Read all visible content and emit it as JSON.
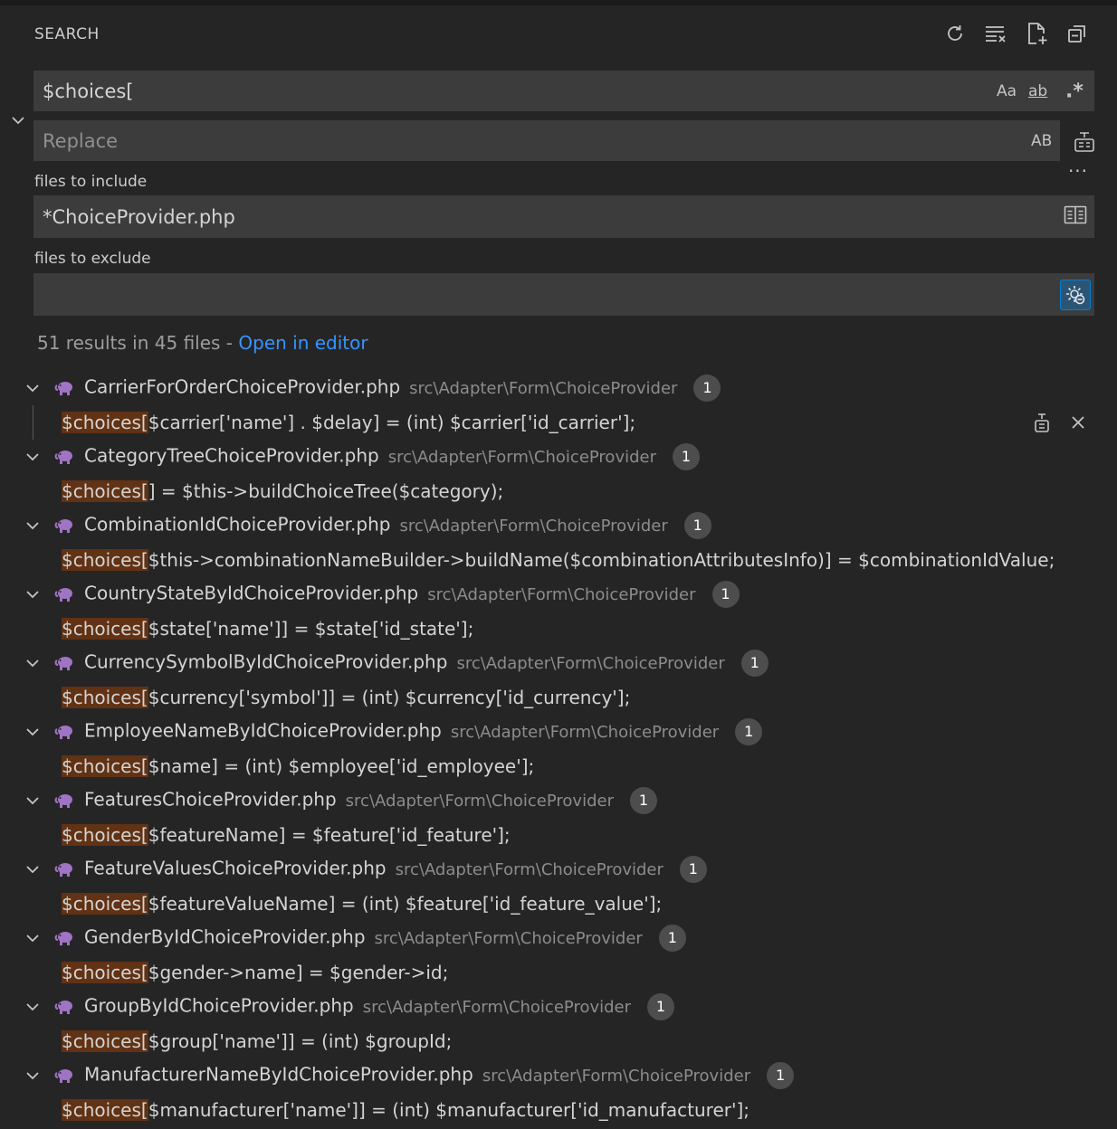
{
  "header": {
    "title": "SEARCH",
    "icons": [
      "refresh-icon",
      "clear-results-icon",
      "new-search-editor-icon",
      "collapse-all-icon"
    ]
  },
  "search": {
    "query": "$choices[",
    "match_case_label": "Aa",
    "whole_word_label": "ab",
    "regex_label": ".*"
  },
  "replace": {
    "placeholder": "Replace",
    "value": "",
    "preserve_case_label": "AB"
  },
  "include": {
    "label": "files to include",
    "value": "*ChoiceProvider.php"
  },
  "exclude": {
    "label": "files to exclude",
    "value": ""
  },
  "summary": {
    "text": "51 results in 45 files - ",
    "link": "Open in editor"
  },
  "results": [
    {
      "file": "CarrierForOrderChoiceProvider.php",
      "path": "src\\Adapter\\Form\\ChoiceProvider",
      "count": "1",
      "match": "$choices[",
      "rest": "$carrier['name'] . $delay] = (int) $carrier['id_carrier'];"
    },
    {
      "file": "CategoryTreeChoiceProvider.php",
      "path": "src\\Adapter\\Form\\ChoiceProvider",
      "count": "1",
      "match": "$choices[",
      "rest": "] = $this->buildChoiceTree($category);"
    },
    {
      "file": "CombinationIdChoiceProvider.php",
      "path": "src\\Adapter\\Form\\ChoiceProvider",
      "count": "1",
      "match": "$choices[",
      "rest": "$this->combinationNameBuilder->buildName($combinationAttributesInfo)] = $combinationIdValue;"
    },
    {
      "file": "CountryStateByIdChoiceProvider.php",
      "path": "src\\Adapter\\Form\\ChoiceProvider",
      "count": "1",
      "match": "$choices[",
      "rest": "$state['name']] = $state['id_state'];"
    },
    {
      "file": "CurrencySymbolByIdChoiceProvider.php",
      "path": "src\\Adapter\\Form\\ChoiceProvider",
      "count": "1",
      "match": "$choices[",
      "rest": "$currency['symbol']] = (int) $currency['id_currency'];"
    },
    {
      "file": "EmployeeNameByIdChoiceProvider.php",
      "path": "src\\Adapter\\Form\\ChoiceProvider",
      "count": "1",
      "match": "$choices[",
      "rest": "$name] = (int) $employee['id_employee'];"
    },
    {
      "file": "FeaturesChoiceProvider.php",
      "path": "src\\Adapter\\Form\\ChoiceProvider",
      "count": "1",
      "match": "$choices[",
      "rest": "$featureName] = $feature['id_feature'];"
    },
    {
      "file": "FeatureValuesChoiceProvider.php",
      "path": "src\\Adapter\\Form\\ChoiceProvider",
      "count": "1",
      "match": "$choices[",
      "rest": "$featureValueName] = (int) $feature['id_feature_value'];"
    },
    {
      "file": "GenderByIdChoiceProvider.php",
      "path": "src\\Adapter\\Form\\ChoiceProvider",
      "count": "1",
      "match": "$choices[",
      "rest": "$gender->name] = $gender->id;"
    },
    {
      "file": "GroupByIdChoiceProvider.php",
      "path": "src\\Adapter\\Form\\ChoiceProvider",
      "count": "1",
      "match": "$choices[",
      "rest": "$group['name']] = (int) $groupId;"
    },
    {
      "file": "ManufacturerNameByIdChoiceProvider.php",
      "path": "src\\Adapter\\Form\\ChoiceProvider",
      "count": "1",
      "match": "$choices[",
      "rest": "$manufacturer['name']] = (int) $manufacturer['id_manufacturer'];"
    }
  ],
  "colors": {
    "panel_bg": "#252526",
    "input_bg": "#3c3c3c",
    "link": "#3794ff",
    "match_highlight": "#613214",
    "badge_bg": "#4d4d4d"
  }
}
